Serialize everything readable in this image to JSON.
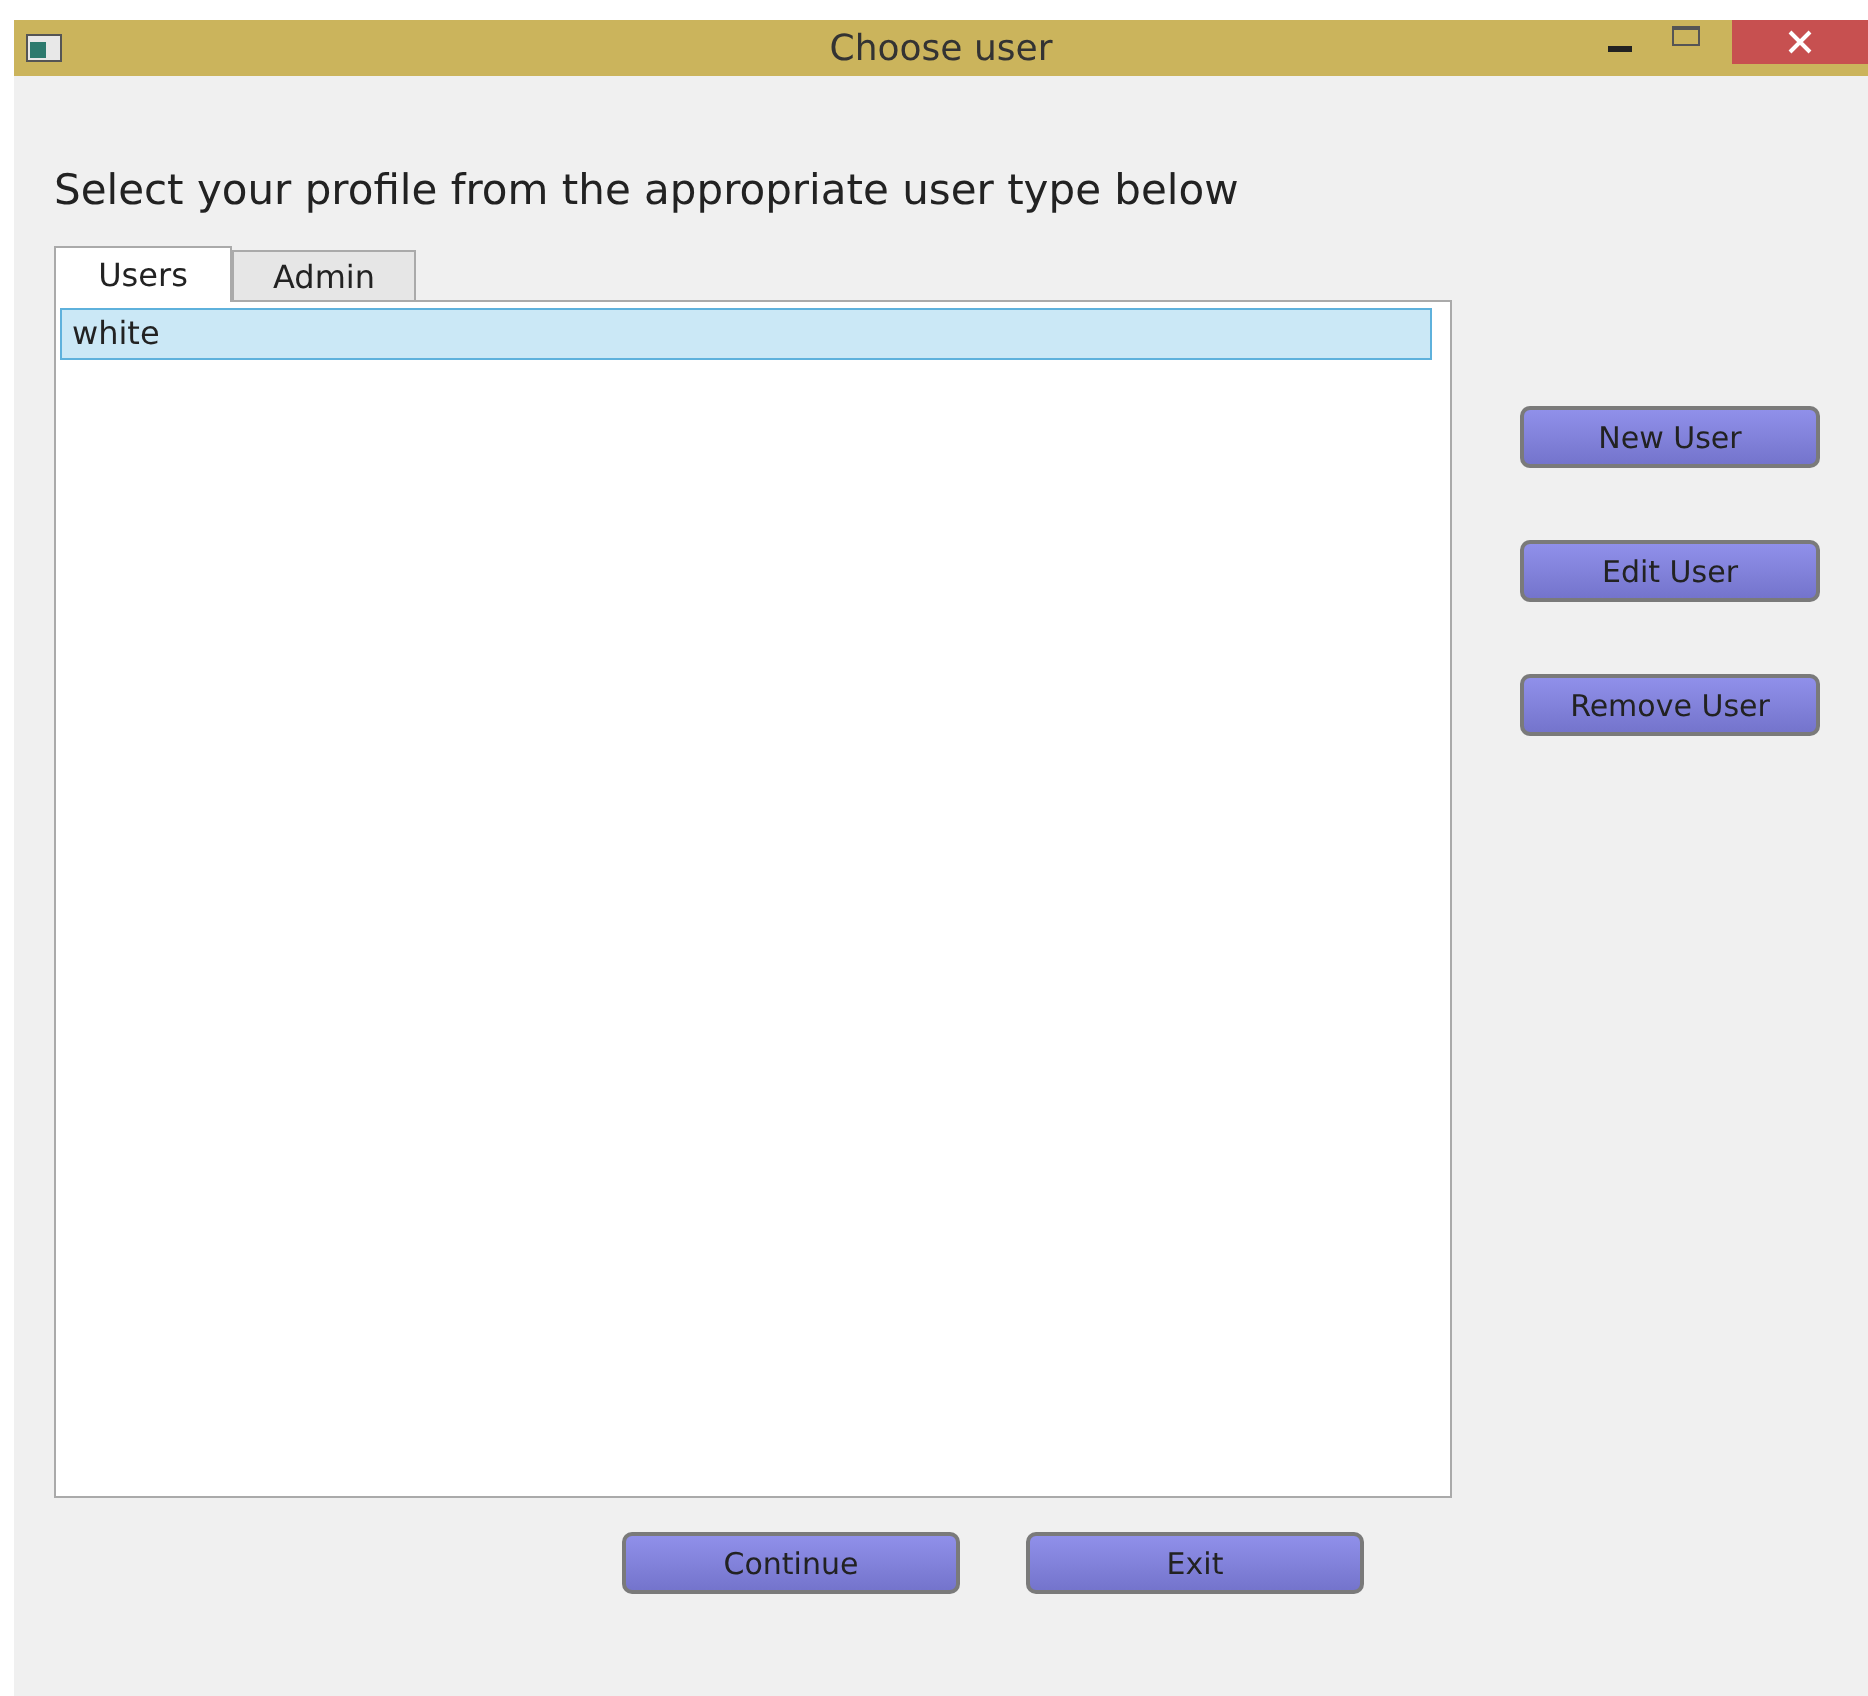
{
  "window": {
    "title": "Choose user"
  },
  "prompt": "Select your profile from the appropriate user type below",
  "tabs": [
    {
      "label": "Users",
      "selected": true
    },
    {
      "label": "Admin",
      "selected": false
    }
  ],
  "users": [
    {
      "name": "white",
      "selected": true
    }
  ],
  "side_buttons": [
    "New User",
    "Edit User",
    "Remove User"
  ],
  "bottom_buttons": [
    "Continue",
    "Exit"
  ]
}
